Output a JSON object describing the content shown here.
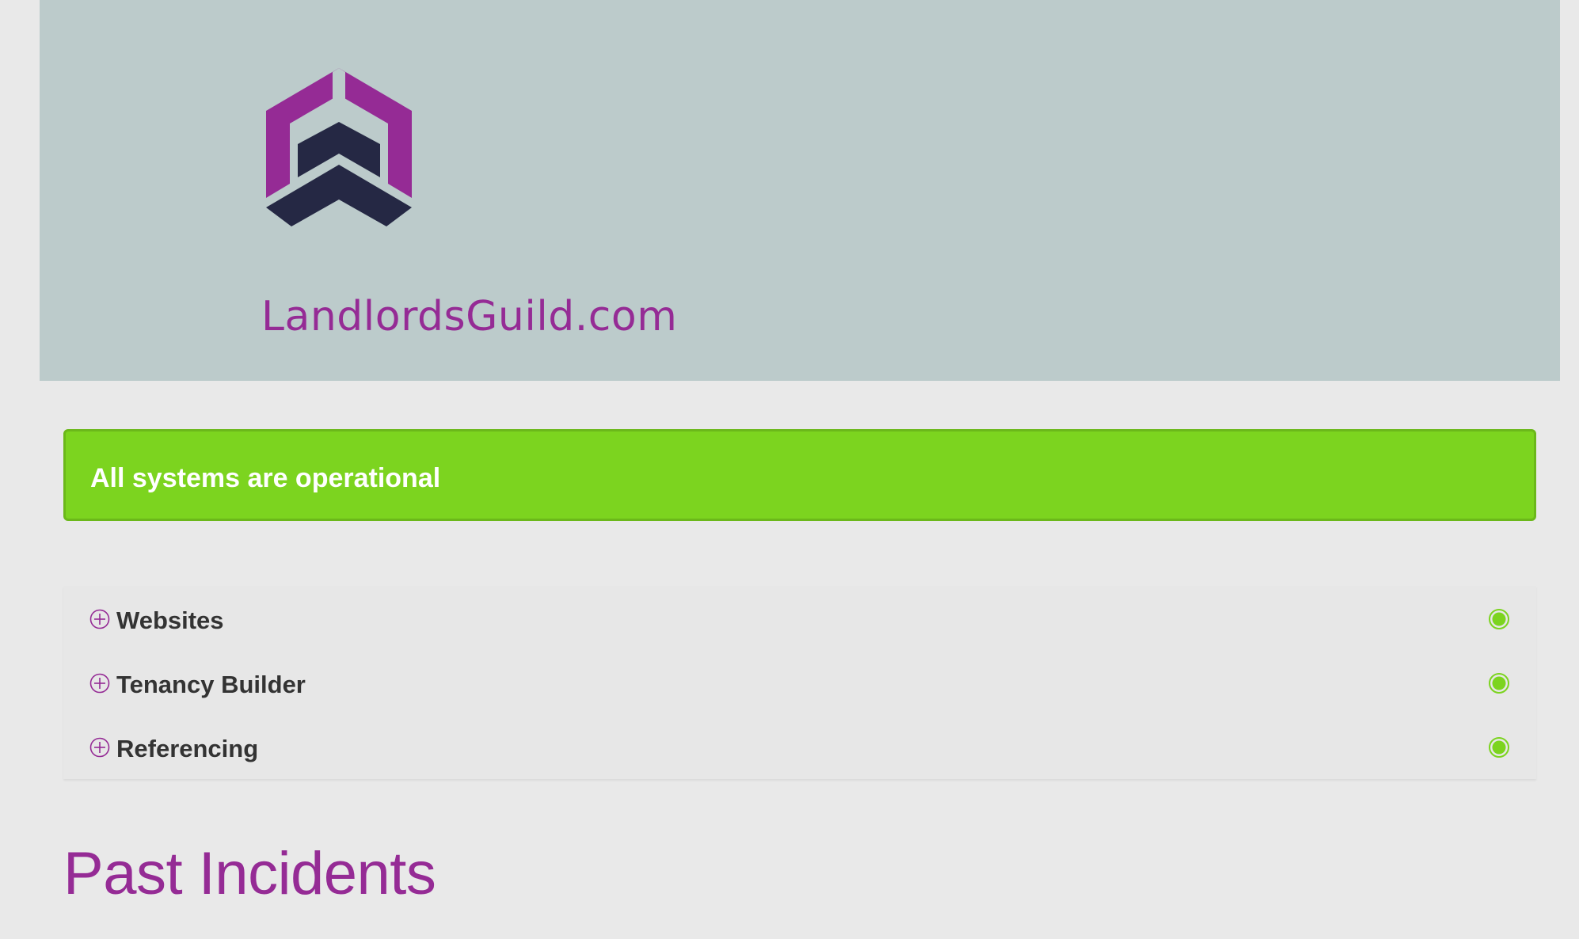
{
  "header": {
    "logo_text": "LandlordsGuild.com",
    "logo_icon": "house-chevron-logo",
    "background_color": "#bccbcb",
    "brand_color": "#952b95",
    "brand_dark_color": "#252844"
  },
  "status": {
    "message": "All systems are operational",
    "color": "#7cd41f"
  },
  "components": [
    {
      "name": "Websites",
      "expand_icon": "plus-circle-icon",
      "status_icon": "operational-dot-icon",
      "status_color": "#7cd41f"
    },
    {
      "name": "Tenancy Builder",
      "expand_icon": "plus-circle-icon",
      "status_icon": "operational-dot-icon",
      "status_color": "#7cd41f"
    },
    {
      "name": "Referencing",
      "expand_icon": "plus-circle-icon",
      "status_icon": "operational-dot-icon",
      "status_color": "#7cd41f"
    }
  ],
  "past_incidents": {
    "title": "Past Incidents"
  }
}
